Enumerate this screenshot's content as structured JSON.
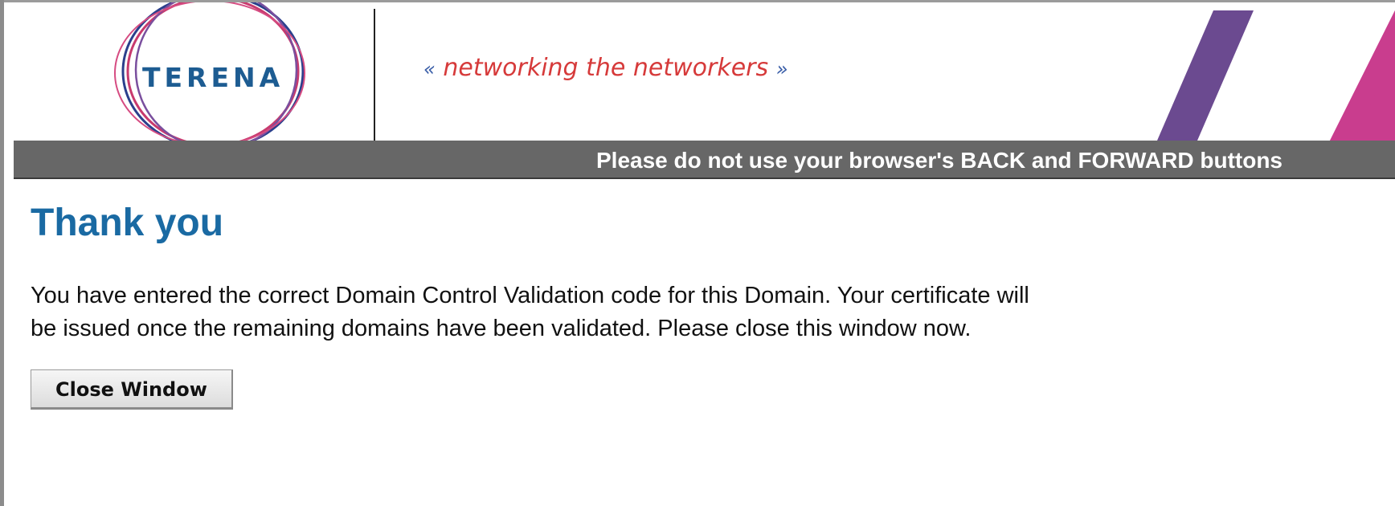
{
  "header": {
    "logo_text": "TERENA",
    "slogan_open": "«",
    "slogan": "networking the networkers",
    "slogan_close": "»"
  },
  "notice": {
    "text": "Please do not use your browser's BACK and FORWARD buttons"
  },
  "main": {
    "title": "Thank you",
    "message_line1": "You have entered the correct Domain Control Validation code for this Domain. Your certificate will",
    "message_line2": "be issued once the remaining domains have been validated. Please close this window now.",
    "close_button_label": "Close Window"
  },
  "colors": {
    "title": "#1a6aa3",
    "slogan": "#d63a3a",
    "notice_bar": "#676767",
    "stripe_purple": "#6b4a90",
    "stripe_magenta": "#c93d8e"
  },
  "icons": {
    "logo": "terena-logo"
  }
}
